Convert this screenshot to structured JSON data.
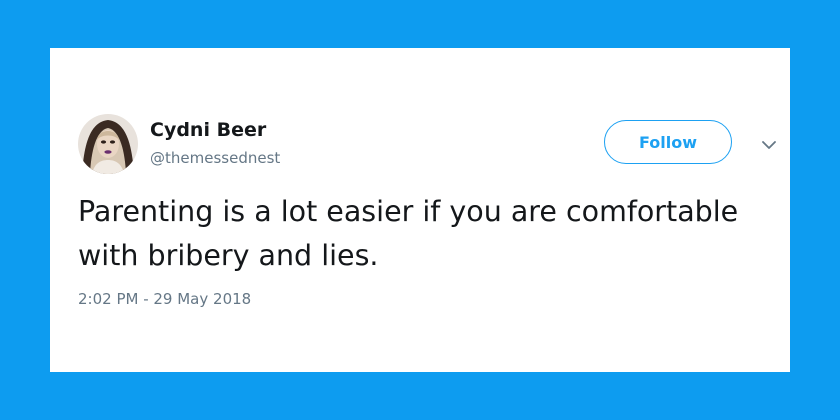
{
  "tweet": {
    "author_name": "Cydni Beer",
    "author_handle": "@themessednest",
    "follow_label": "Follow",
    "text": "Parenting is a lot easier if you are comfortable with bribery and lies.",
    "timestamp": "2:02 PM - 29 May 2018"
  },
  "icons": {
    "menu": "chevron-down-icon"
  },
  "colors": {
    "background": "#0d9cf0",
    "card": "#ffffff",
    "accent": "#1da1f2",
    "text_primary": "#14171a",
    "text_secondary": "#657786"
  }
}
